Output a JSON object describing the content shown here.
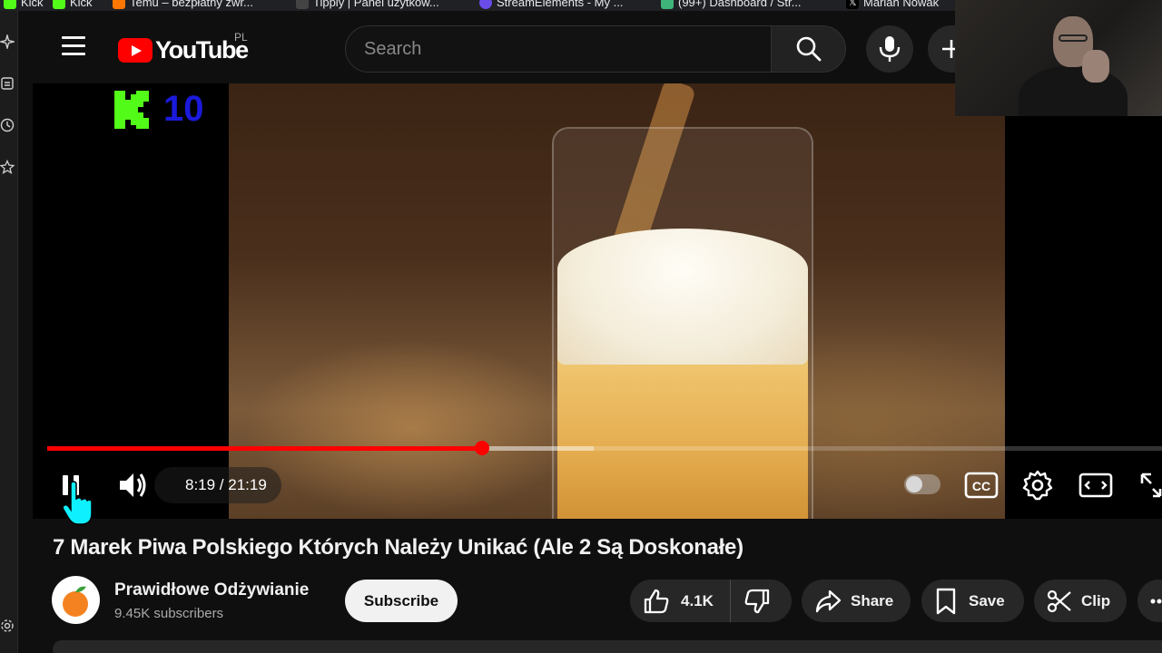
{
  "bookmarks": [
    {
      "label": "Kick",
      "color": "#53fc18"
    },
    {
      "label": "Kick",
      "color": "#53fc18"
    },
    {
      "label": "Temu – bezpłatny zwr...",
      "color": "#fb7701"
    },
    {
      "label": "Tipply | Panel użytkow...",
      "color": "#444444"
    },
    {
      "label": "StreamElements - My ...",
      "color": "#6a4ce8"
    },
    {
      "label": "(99+) Dashboard / Str...",
      "color": "#3fb47a"
    },
    {
      "label": "Marian Nowak",
      "color": "#000000"
    }
  ],
  "header": {
    "logo_text": "YouTube",
    "region": "PL",
    "search_placeholder": "Search"
  },
  "overlay": {
    "kick_count": "10"
  },
  "player": {
    "current_time": "8:19",
    "duration": "21:19",
    "time_text": "8:19 / 21:19",
    "progress_fraction": 0.39,
    "buffer_fraction": 0.49,
    "state": "playing"
  },
  "video": {
    "title": "7 Marek Piwa Polskiego Których Należy Unikać (Ale 2 Są Doskonałe)",
    "channel_name": "Prawidłowe Odżywianie",
    "subscribers": "9.45K subscribers",
    "subscribe_label": "Subscribe",
    "likes": "4.1K",
    "share_label": "Share",
    "save_label": "Save",
    "clip_label": "Clip"
  },
  "colors": {
    "accent": "#ff0000",
    "background": "#0f0f0f",
    "pill": "#272727"
  }
}
